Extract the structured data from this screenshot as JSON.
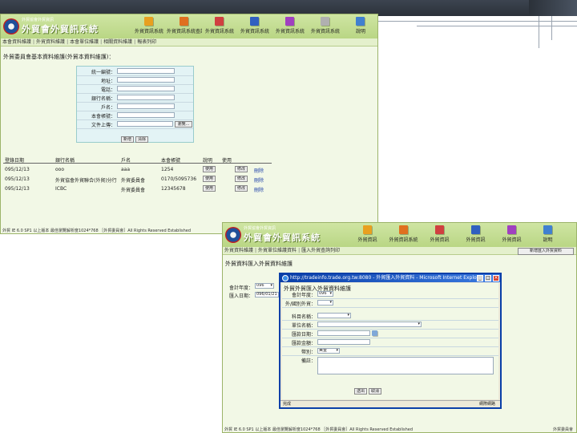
{
  "shot1": {
    "sub_title": "外貿協會外貿資訊",
    "brand": "外貿會外貿訊系統",
    "toolbar": [
      {
        "label": "外貿資訊系統",
        "color": "#e8a020"
      },
      {
        "label": "外貿資訊系統查詢",
        "color": "#e07020"
      },
      {
        "label": "外貿資訊系統",
        "color": "#d04040"
      },
      {
        "label": "外貿資訊系統",
        "color": "#3060c0"
      },
      {
        "label": "外貿資訊系統",
        "color": "#a040c0"
      },
      {
        "label": "外貿資訊系統",
        "color": "#b0b0b0"
      },
      {
        "label": "說明",
        "color": "#4080d0"
      }
    ],
    "nav": [
      "本會資料維護",
      "外貿資料維護",
      "本會單位維護",
      "相關資料維護",
      "報表列印"
    ],
    "page_title": "外貿委員會基本資料維護(外貿本資料維護)：",
    "form": {
      "labels": [
        "統一編號：",
        "地址：",
        "電話：",
        "銀行名稱：",
        "戶名：",
        "本會帳號：",
        "文件上傳："
      ],
      "browse": "瀏覽...",
      "submit": "新增",
      "reset": "清除"
    },
    "table": {
      "headers": [
        "登錄日期",
        "銀行名稱",
        "戶名",
        "本會帳號",
        "說明",
        "使用"
      ],
      "rows": [
        [
          "095/12/13",
          "ooo",
          "aaa",
          "1254",
          "使用",
          "修改",
          "刪除"
        ],
        [
          "095/12/13",
          "外貿協會外貿聯合(外貿)分行",
          "外貿委員會",
          "0170/5095736",
          "使用",
          "修改",
          "刪除"
        ],
        [
          "095/12/13",
          "ICBC",
          "外貿委員會",
          "12345678",
          "使用",
          "修改",
          "刪除"
        ]
      ]
    },
    "footer": "外貿 IE 6.0 SP1 以上版本 最佳瀏覽解析度1024*768 ［外貿委員會］All Rights Reserved Established"
  },
  "shot2": {
    "sub_title": "外貿協會外貿資訊",
    "brand": "外貿會外貿訊系統",
    "toolbar": [
      {
        "label": "外貿資訊",
        "color": "#e8a020"
      },
      {
        "label": "外貿資訊系統",
        "color": "#e07020"
      },
      {
        "label": "外貿資訊",
        "color": "#d04040"
      },
      {
        "label": "外貿資訊",
        "color": "#3060c0"
      },
      {
        "label": "外貿資訊",
        "color": "#a040c0"
      },
      {
        "label": "說明",
        "color": "#4080d0"
      }
    ],
    "nav": [
      "外貿資料維護",
      "外貿單位維護資料",
      "匯入外貿查詢列印"
    ],
    "page_title": "外貿資料匯入外貿資料維護",
    "top_button": "新增匯入外貿資料",
    "left_labels": [
      "會計年度：",
      "匯入日期："
    ],
    "year_value": "096",
    "date_value": "096/01/21",
    "dialog": {
      "window_title": "http://tradeinfo.trade.org.tw:8080 - 外貿匯入外貿資料 - Microsoft Internet Explorer",
      "header": "外貿外貿匯入外貿資料維護",
      "labels": [
        "會計年度：",
        "外/國別外貿：",
        "科目名稱：",
        "單位名稱：",
        "匯款日期：",
        "匯款金額：",
        "幣別：",
        "備註："
      ],
      "year_value": "096",
      "currency_value": "美金",
      "submit": "送出",
      "cancel": "取消",
      "status_left": "完成",
      "status_right": "網際網路"
    },
    "footer": "外貿 IE 6.0 SP1 以上版本 最佳瀏覽解析度1024*768 ［外貿委員會］All Rights Reserved Established",
    "footer_right": "外貿委員會"
  }
}
